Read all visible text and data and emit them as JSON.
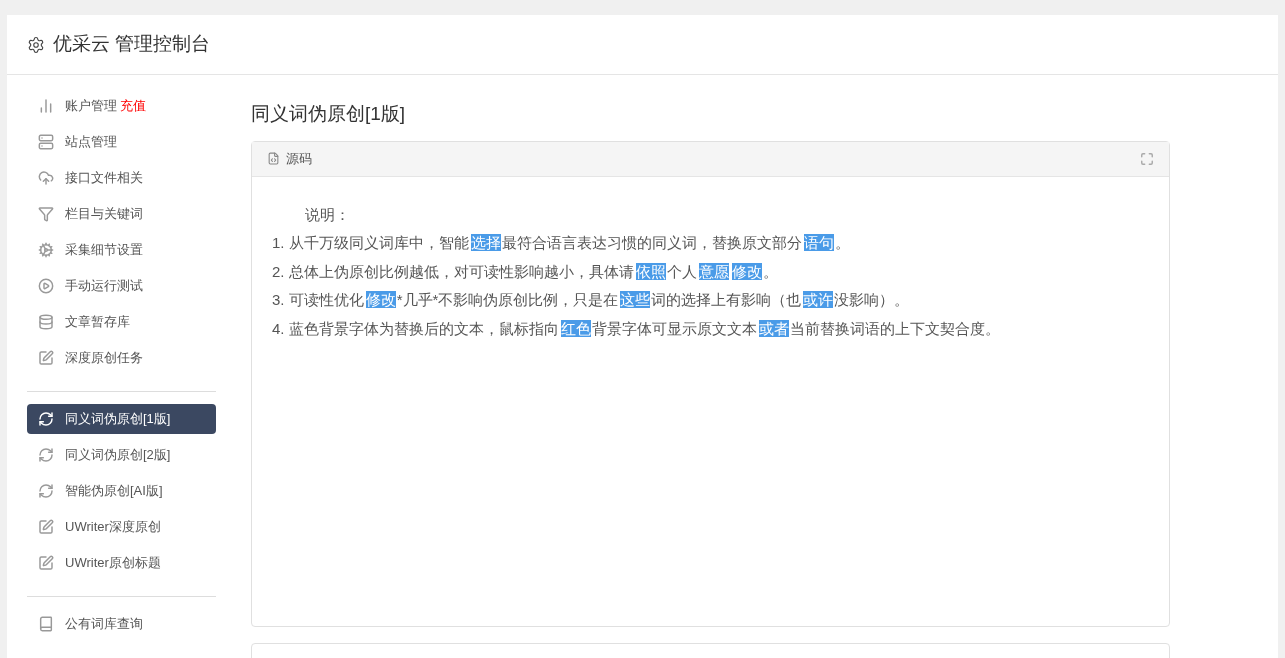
{
  "header": {
    "title": "优采云 管理控制台"
  },
  "sidebar": {
    "groups": [
      {
        "items": [
          {
            "label": "账户管理",
            "badge": "充值",
            "selected": false
          },
          {
            "label": "站点管理",
            "selected": false
          },
          {
            "label": "接口文件相关",
            "selected": false
          },
          {
            "label": "栏目与关键词",
            "selected": false
          },
          {
            "label": "采集细节设置",
            "selected": false
          },
          {
            "label": "手动运行测试",
            "selected": false
          },
          {
            "label": "文章暂存库",
            "selected": false
          },
          {
            "label": "深度原创任务",
            "selected": false
          }
        ]
      },
      {
        "items": [
          {
            "label": "同义词伪原创[1版]",
            "selected": true
          },
          {
            "label": "同义词伪原创[2版]",
            "selected": false
          },
          {
            "label": "智能伪原创[AI版]",
            "selected": false
          },
          {
            "label": "UWriter深度原创",
            "selected": false
          },
          {
            "label": "UWriter原创标题",
            "selected": false
          }
        ]
      },
      {
        "items": [
          {
            "label": "公有词库查询",
            "selected": false
          }
        ]
      }
    ]
  },
  "content": {
    "title": "同义词伪原创[1版]",
    "panel": {
      "tab": "源码",
      "intro": "说明：",
      "lines": [
        [
          {
            "text": "1. 从千万级同义词库中，智能"
          },
          {
            "text": "选择",
            "highlight": true
          },
          {
            "text": "最符合语言表达习惯的同义词，替换原文部分"
          },
          {
            "text": "语句",
            "highlight": true
          },
          {
            "text": "。"
          }
        ],
        [
          {
            "text": "2. 总体上伪原创比例越低，对可读性影响越小，具体请"
          },
          {
            "text": "依照",
            "highlight": true
          },
          {
            "text": "个人"
          },
          {
            "text": "意愿",
            "highlight": true
          },
          {
            "text": "修改",
            "highlight": true
          },
          {
            "text": "。"
          }
        ],
        [
          {
            "text": "3. 可读性优化"
          },
          {
            "text": "修改",
            "highlight": true
          },
          {
            "text": "*几乎*不影响伪原创比例，只是在"
          },
          {
            "text": "这些",
            "highlight": true
          },
          {
            "text": "词的选择上有影响（也"
          },
          {
            "text": "或许",
            "highlight": true
          },
          {
            "text": "没影响）。"
          }
        ],
        [
          {
            "text": "4. 蓝色背景字体为替换后的文本，鼠标指向"
          },
          {
            "text": "红色",
            "highlight": true
          },
          {
            "text": "背景字体可显示原文文本"
          },
          {
            "text": "或者",
            "highlight": true
          },
          {
            "text": "当前替换词语的上下文契合度。"
          }
        ]
      ]
    }
  }
}
